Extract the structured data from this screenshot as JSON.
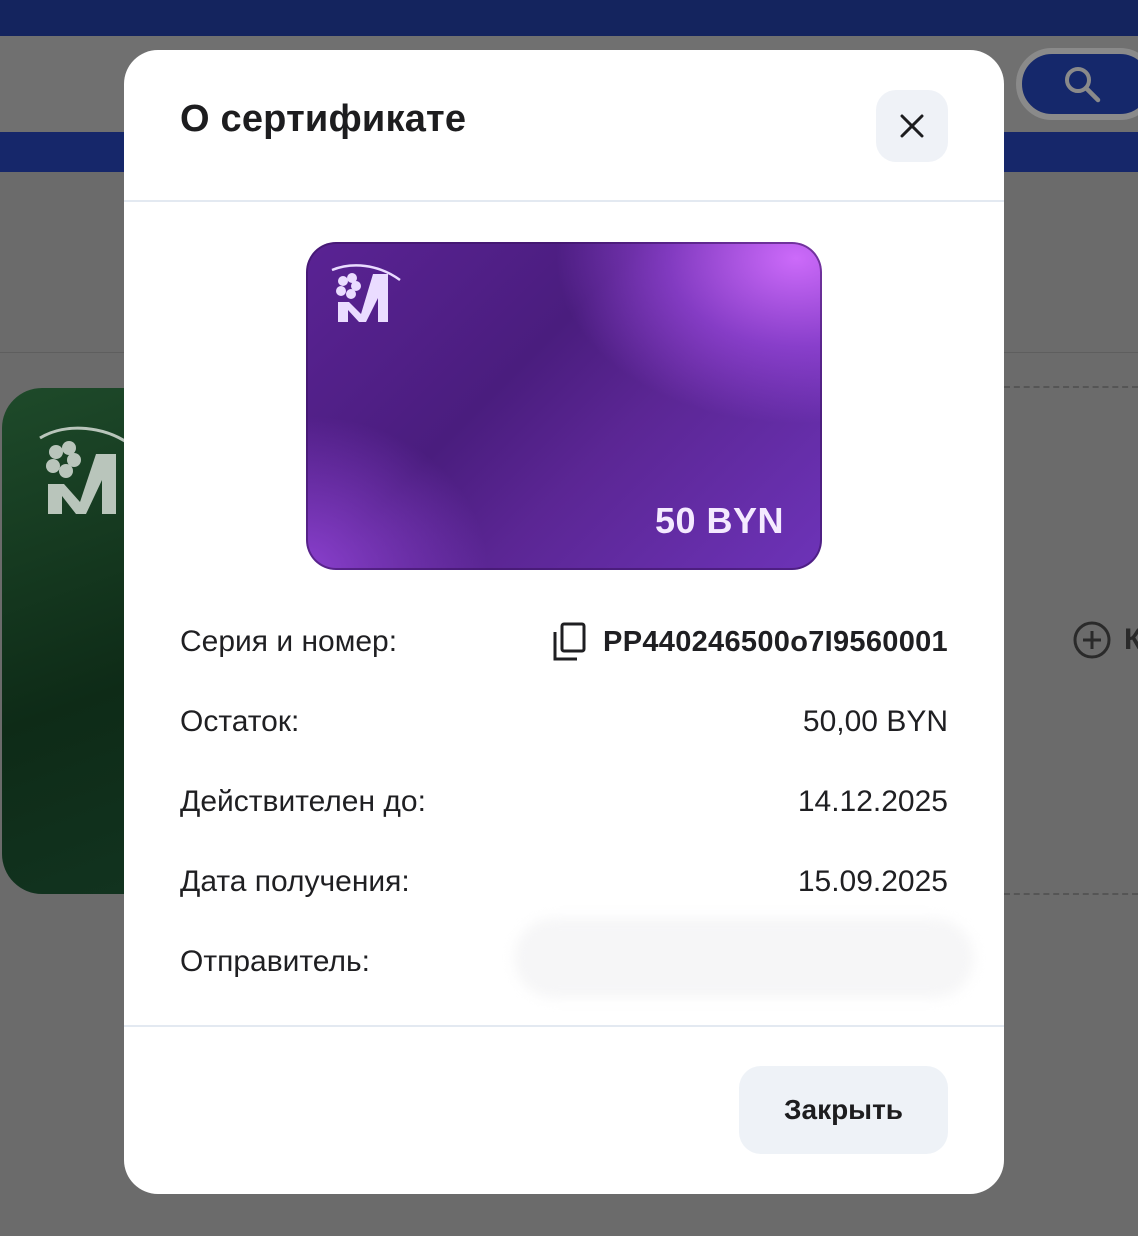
{
  "background": {
    "add_button_label": "К",
    "search_icon": "search-icon"
  },
  "modal": {
    "title": "О сертификате",
    "close_icon": "close-icon",
    "card": {
      "amount": "50 BYN",
      "logo_letter": "М"
    },
    "details": [
      {
        "label": "Серия и номер:",
        "value": "PP440246500o7I9560001"
      },
      {
        "label": "Остаток:",
        "value": "50,00 BYN"
      },
      {
        "label": "Действителен до:",
        "value": "14.12.2025"
      },
      {
        "label": "Дата получения:",
        "value": "15.09.2025"
      },
      {
        "label": "Отправитель:",
        "value": ""
      }
    ],
    "footer_button": "Закрыть"
  },
  "colors": {
    "brand_navy": "#14245e",
    "card_purple": "#5a2394",
    "overlay": "#6b6b6b"
  }
}
